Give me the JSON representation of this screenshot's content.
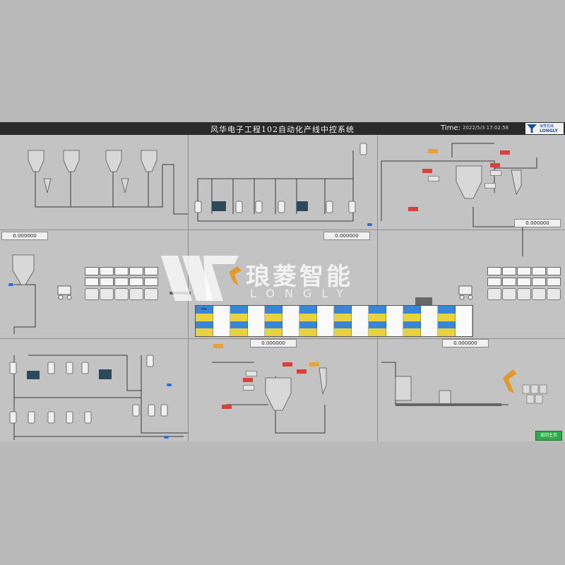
{
  "titlebar": {
    "title": "风华电子工程102自动化产线中控系统",
    "time_label": "Time:",
    "time_value": "2022/5/3 17:02:58"
  },
  "logo": {
    "name_cn": "琅菱机械",
    "name_en": "LONGLY",
    "color": "#1b4f9c"
  },
  "watermark": {
    "brand_cn": "琅菱智能",
    "brand_en": "LONGLY"
  },
  "readouts": {
    "top_left": "0.000000",
    "top_middle": "0.000000",
    "top_right": "0.000000",
    "mid_middle": "0.000000",
    "mid_right": "0.000000"
  },
  "status_table": {
    "rows": [
      {
        "color": "#3a86d6",
        "cells": [
          "Mid",
          "",
          "",
          "",
          "",
          "",
          "",
          "",
          "",
          "",
          "",
          "",
          "",
          "",
          "",
          ""
        ]
      },
      {
        "color": "#49b34a",
        "cells": [
          "",
          "",
          "",
          "",
          "",
          "",
          "",
          "",
          "",
          "",
          "",
          "",
          "",
          "",
          "",
          ""
        ]
      },
      {
        "color": "#3a86d6",
        "cells": [
          "",
          "",
          "",
          "",
          "",
          "",
          "",
          "",
          "",
          "",
          "",
          "",
          "",
          "",
          "",
          ""
        ]
      },
      {
        "color": "#e8d23e",
        "cells": [
          "",
          "",
          "",
          "",
          "",
          "",
          "",
          "",
          "",
          "",
          "",
          "",
          "",
          "",
          "",
          ""
        ]
      }
    ]
  },
  "buttons": {
    "bottom_right": "返回主页"
  },
  "colors": {
    "background": "#c3c3c3",
    "titlebar": "#2a2a2a",
    "run_green": "#2eaa4d",
    "alarm_red": "#d9423a",
    "pipe_blue": "#2d6fd0"
  }
}
